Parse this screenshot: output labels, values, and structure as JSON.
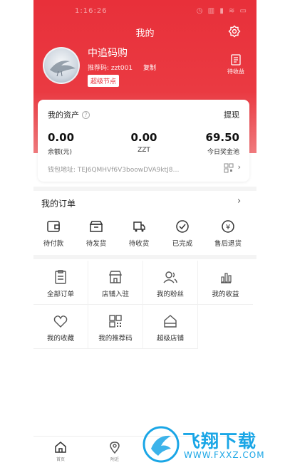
{
  "status_bar": {
    "time": "1:16:26",
    "icons": "◷ ▥ ▮ ≋ ▭"
  },
  "header": {
    "title": "我的",
    "settings_icon": "settings-icon"
  },
  "profile": {
    "name": "中追码购",
    "referral_label": "推荐码: zzt001",
    "copy_label": "复制",
    "badge": "超级节点",
    "earnings_label": "待收益"
  },
  "assets": {
    "title": "我的资产",
    "withdraw": "提现",
    "items": [
      {
        "value": "0.00",
        "label": "余额(元)"
      },
      {
        "value": "0.00",
        "label": "ZZT"
      },
      {
        "value": "69.50",
        "label": "今日奖金池"
      }
    ],
    "wallet": "钱包地址: TEJ6QMHVf6V3boowDVA9ktJ8…"
  },
  "orders": {
    "title": "我的订单",
    "items": [
      {
        "label": "待付款",
        "icon": "wallet-icon"
      },
      {
        "label": "待发货",
        "icon": "package-icon"
      },
      {
        "label": "待收货",
        "icon": "truck-icon"
      },
      {
        "label": "已完成",
        "icon": "check-circle-icon"
      },
      {
        "label": "售后退货",
        "icon": "refund-icon"
      }
    ]
  },
  "services": [
    {
      "label": "全部订单",
      "icon": "order-list-icon"
    },
    {
      "label": "店铺入驻",
      "icon": "store-icon"
    },
    {
      "label": "我的粉丝",
      "icon": "fans-icon"
    },
    {
      "label": "我的收益",
      "icon": "earnings-icon"
    },
    {
      "label": "我的收藏",
      "icon": "heart-icon"
    },
    {
      "label": "我的推荐码",
      "icon": "qr-code-icon"
    },
    {
      "label": "超级店铺",
      "icon": "super-store-icon"
    }
  ],
  "tabbar": [
    {
      "label": "首页",
      "icon": "home-icon"
    },
    {
      "label": "附近",
      "icon": "location-icon"
    }
  ],
  "watermark": {
    "title": "飞翔下载",
    "url": "WWW.FXXZ.COM"
  },
  "colors": {
    "brand": "#e8303a",
    "watermark": "#1aa6e6"
  }
}
